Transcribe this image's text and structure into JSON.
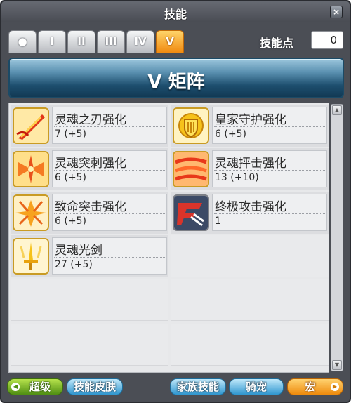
{
  "window": {
    "title": "技能",
    "close": "×"
  },
  "tabs": [
    {
      "label": "●",
      "active": false
    },
    {
      "label": "I",
      "active": false
    },
    {
      "label": "II",
      "active": false
    },
    {
      "label": "III",
      "active": false
    },
    {
      "label": "IV",
      "active": false
    },
    {
      "label": "V",
      "active": true
    }
  ],
  "skill_points": {
    "label": "技能点",
    "value": "0"
  },
  "banner": {
    "title": "V 矩阵"
  },
  "skills": [
    {
      "name": "灵魂之刃强化",
      "level": "7  (+5)",
      "icon": "soul-blade-icon"
    },
    {
      "name": "皇家守护强化",
      "level": "6  (+5)",
      "icon": "royal-guard-icon"
    },
    {
      "name": "灵魂突刺强化",
      "level": "6  (+5)",
      "icon": "soul-pierce-icon"
    },
    {
      "name": "灵魂抨击强化",
      "level": "13  (+10)",
      "icon": "soul-assault-icon"
    },
    {
      "name": "致命突击强化",
      "level": "6  (+5)",
      "icon": "fatal-strike-icon"
    },
    {
      "name": "终极攻击强化",
      "level": "1",
      "icon": "final-attack-icon"
    },
    {
      "name": "灵魂光剑",
      "level": "27  (+5)",
      "icon": "soul-sword-icon"
    }
  ],
  "buttons": {
    "prev": "超级",
    "skin": "技能皮肤",
    "family": "家族技能",
    "mount": "骑宠",
    "macro": "宏"
  },
  "colors": {
    "frame": "#4b4e55",
    "banner": "#1d4e6e",
    "tab_active": "#f08a10",
    "button_green": "#4f8e12",
    "button_blue": "#2f96cf",
    "button_orange": "#ee8a0c"
  }
}
